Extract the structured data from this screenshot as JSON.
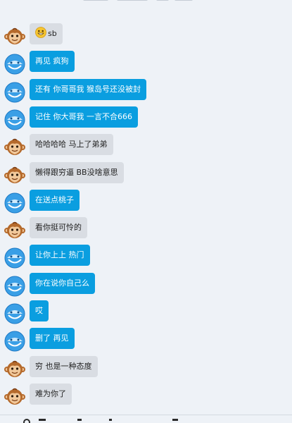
{
  "messages": [
    {
      "side": "them",
      "avatar": "monkey-avatar",
      "emoji": "grinning-emoji",
      "text": "sb"
    },
    {
      "side": "me",
      "avatar": "blue-avatar",
      "text": "再见 疯狗"
    },
    {
      "side": "me",
      "avatar": "blue-avatar",
      "text": "还有 你哥哥我 猴岛号还没被封"
    },
    {
      "side": "me",
      "avatar": "blue-avatar",
      "text": "记住 你大哥我 一言不合666"
    },
    {
      "side": "them",
      "avatar": "monkey-avatar",
      "text": "哈哈哈哈 马上了弟弟"
    },
    {
      "side": "them",
      "avatar": "monkey-avatar",
      "text": "懒得跟穷逼 BB没啥意思"
    },
    {
      "side": "me",
      "avatar": "blue-avatar",
      "text": "在送点桃子"
    },
    {
      "side": "them",
      "avatar": "monkey-avatar",
      "text": "看你挺可怜的"
    },
    {
      "side": "me",
      "avatar": "blue-avatar",
      "text": "让你上上 热门"
    },
    {
      "side": "me",
      "avatar": "blue-avatar",
      "text": "你在说你自己么"
    },
    {
      "side": "me",
      "avatar": "blue-avatar",
      "text": "哎"
    },
    {
      "side": "me",
      "avatar": "blue-avatar",
      "text": "删了 再见"
    },
    {
      "side": "them",
      "avatar": "monkey-avatar",
      "text": "穷 也是一种态度"
    },
    {
      "side": "them",
      "avatar": "monkey-avatar",
      "text": "难为你了"
    }
  ],
  "colors": {
    "background": "#eef2f7",
    "bubble_me": "#0a9ee0",
    "bubble_them": "#d9dde3"
  }
}
